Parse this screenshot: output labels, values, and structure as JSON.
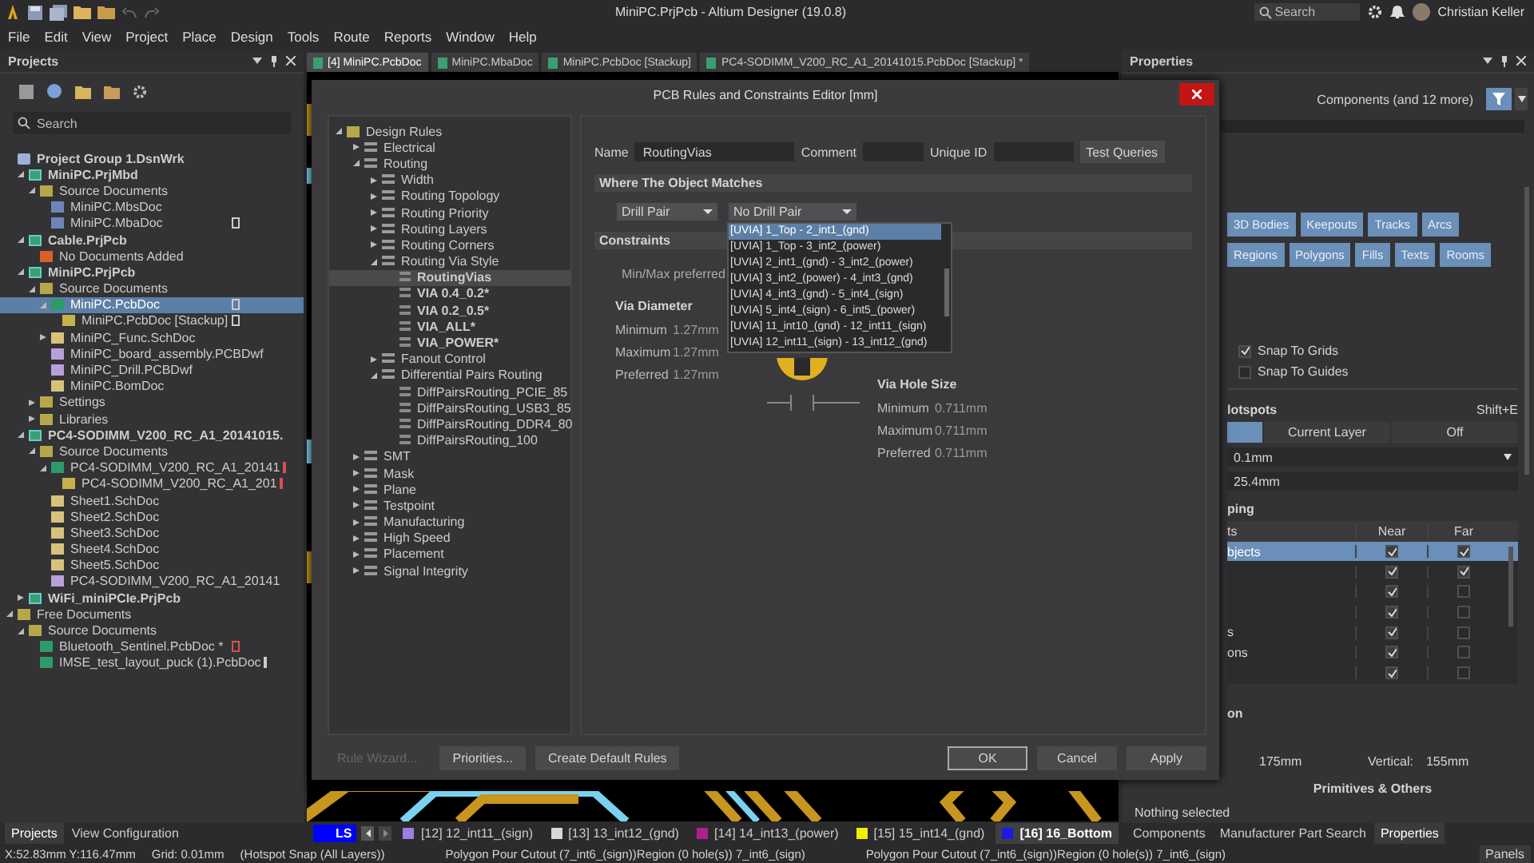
{
  "titlebar": {
    "title": "MiniPC.PrjPcb - Altium Designer (19.0.8)",
    "search": {
      "placeholder": "Search"
    },
    "user": "Christian Keller"
  },
  "menu": [
    "File",
    "Edit",
    "View",
    "Project",
    "Place",
    "Design",
    "Tools",
    "Route",
    "Reports",
    "Window",
    "Help"
  ],
  "projects_panel": {
    "title": "Projects",
    "search": {
      "placeholder": "Search"
    },
    "tree": [
      {
        "label": "Project Group 1.DsnWrk",
        "kind": "workspace",
        "selected": false,
        "children": [
          {
            "label": "MiniPC.PrjMbd",
            "kind": "project",
            "selected": false,
            "expanded": true,
            "children": [
              {
                "label": "Source Documents",
                "kind": "folder",
                "selected": false,
                "expanded": true,
                "children": [
                  {
                    "label": "MiniPC.MbsDoc",
                    "kind": "doc",
                    "selected": false
                  },
                  {
                    "label": "MiniPC.MbaDoc",
                    "kind": "doc",
                    "selected": false,
                    "modified": false
                  }
                ]
              }
            ]
          },
          {
            "label": "Cable.PrjPcb",
            "kind": "project",
            "selected": false,
            "expanded": true,
            "children": [
              {
                "label": "No Documents Added",
                "kind": "empty",
                "selected": false
              }
            ]
          },
          {
            "label": "MiniPC.PrjPcb",
            "kind": "project",
            "selected": false,
            "expanded": true,
            "children": [
              {
                "label": "Source Documents",
                "kind": "folder",
                "selected": false,
                "expanded": true,
                "children": [
                  {
                    "label": "MiniPC.PcbDoc",
                    "kind": "pcb",
                    "selected": true,
                    "expanded": true,
                    "modified": false,
                    "children": [
                      {
                        "label": "MiniPC.PcbDoc [Stackup]",
                        "kind": "stackup",
                        "selected": false,
                        "modified": false
                      }
                    ]
                  },
                  {
                    "label": "MiniPC_Func.SchDoc",
                    "kind": "sch",
                    "selected": false,
                    "expanded": false
                  },
                  {
                    "label": "MiniPC_board_assembly.PCBDwf",
                    "kind": "dwf",
                    "selected": false
                  },
                  {
                    "label": "MiniPC_Drill.PCBDwf",
                    "kind": "dwf",
                    "selected": false
                  },
                  {
                    "label": "MiniPC.BomDoc",
                    "kind": "sch",
                    "selected": false
                  }
                ]
              },
              {
                "label": "Settings",
                "kind": "folder",
                "selected": false,
                "expanded": false
              },
              {
                "label": "Libraries",
                "kind": "folder",
                "selected": false,
                "expanded": false
              }
            ]
          },
          {
            "label": "PC4-SODIMM_V200_RC_A1_20141015.",
            "kind": "project",
            "selected": false,
            "expanded": true,
            "children": [
              {
                "label": "Source Documents",
                "kind": "folder",
                "selected": false,
                "expanded": true,
                "children": [
                  {
                    "label": "PC4-SODIMM_V200_RC_A1_20141",
                    "kind": "pcb",
                    "selected": false,
                    "expanded": true,
                    "modified": true,
                    "children": [
                      {
                        "label": "PC4-SODIMM_V200_RC_A1_201",
                        "kind": "stackup",
                        "selected": false,
                        "modified": true
                      }
                    ]
                  },
                  {
                    "label": "Sheet1.SchDoc",
                    "kind": "sch",
                    "selected": false
                  },
                  {
                    "label": "Sheet2.SchDoc",
                    "kind": "sch",
                    "selected": false
                  },
                  {
                    "label": "Sheet3.SchDoc",
                    "kind": "sch",
                    "selected": false
                  },
                  {
                    "label": "Sheet4.SchDoc",
                    "kind": "sch",
                    "selected": false
                  },
                  {
                    "label": "Sheet5.SchDoc",
                    "kind": "sch",
                    "selected": false
                  },
                  {
                    "label": "PC4-SODIMM_V200_RC_A1_20141",
                    "kind": "dwf",
                    "selected": false
                  }
                ]
              }
            ]
          },
          {
            "label": "WiFi_miniPCIe.PrjPcb",
            "kind": "project",
            "selected": false,
            "expanded": false
          }
        ]
      },
      {
        "label": "Free Documents",
        "kind": "folder",
        "selected": false,
        "expanded": true,
        "children": [
          {
            "label": "Source Documents",
            "kind": "folder",
            "selected": false,
            "expanded": true,
            "children": [
              {
                "label": "Bluetooth_Sentinel.PcbDoc *",
                "kind": "pcb",
                "selected": false,
                "modified": true
              },
              {
                "label": "IMSE_test_layout_puck (1).PcbDoc",
                "kind": "pcb",
                "selected": false,
                "modified": false
              }
            ]
          }
        ]
      }
    ],
    "tabs": [
      {
        "label": "Projects",
        "selected": true
      },
      {
        "label": "View Configuration",
        "selected": false
      }
    ]
  },
  "document_tabs": [
    {
      "label": "[4] MiniPC.PcbDoc",
      "selected": true
    },
    {
      "label": "MiniPC.MbaDoc",
      "selected": false
    },
    {
      "label": "MiniPC.PcbDoc [Stackup]",
      "selected": false
    },
    {
      "label": "PC4-SODIMM_V200_RC_A1_20141015.PcbDoc [Stackup] *",
      "selected": false
    }
  ],
  "dialog": {
    "title": "PCB Rules and Constraints Editor [mm]",
    "rule_tree": [
      {
        "label": "Design Rules",
        "kind": "root",
        "selected": false,
        "expanded": true,
        "children": [
          {
            "label": "Electrical",
            "kind": "category",
            "selected": false,
            "expanded": false
          },
          {
            "label": "Routing",
            "kind": "category",
            "selected": false,
            "expanded": true,
            "children": [
              {
                "label": "Width",
                "kind": "category",
                "selected": false,
                "expanded": false
              },
              {
                "label": "Routing Topology",
                "kind": "category",
                "selected": false,
                "expanded": false
              },
              {
                "label": "Routing Priority",
                "kind": "category",
                "selected": false,
                "expanded": false
              },
              {
                "label": "Routing Layers",
                "kind": "category",
                "selected": false,
                "expanded": false
              },
              {
                "label": "Routing Corners",
                "kind": "category",
                "selected": false,
                "expanded": false
              },
              {
                "label": "Routing Via Style",
                "kind": "category",
                "selected": false,
                "expanded": true,
                "children": [
                  {
                    "label": "RoutingVias",
                    "kind": "rule",
                    "selected": true,
                    "bold": true
                  },
                  {
                    "label": "VIA 0.4_0.2*",
                    "kind": "rule",
                    "selected": false,
                    "bold": true
                  },
                  {
                    "label": "VIA 0.2_0.5*",
                    "kind": "rule",
                    "selected": false,
                    "bold": true
                  },
                  {
                    "label": "VIA_ALL*",
                    "kind": "rule",
                    "selected": false,
                    "bold": true
                  },
                  {
                    "label": "VIA_POWER*",
                    "kind": "rule",
                    "selected": false,
                    "bold": true
                  }
                ]
              },
              {
                "label": "Fanout Control",
                "kind": "category",
                "selected": false,
                "expanded": false
              },
              {
                "label": "Differential Pairs Routing",
                "kind": "category",
                "selected": false,
                "expanded": true,
                "children": [
                  {
                    "label": "DiffPairsRouting_PCIE_85",
                    "kind": "rule",
                    "selected": false,
                    "bold": false
                  },
                  {
                    "label": "DiffPairsRouting_USB3_85",
                    "kind": "rule",
                    "selected": false,
                    "bold": false
                  },
                  {
                    "label": "DiffPairsRouting_DDR4_80",
                    "kind": "rule",
                    "selected": false,
                    "bold": false
                  },
                  {
                    "label": "DiffPairsRouting_100",
                    "kind": "rule",
                    "selected": false,
                    "bold": false
                  }
                ]
              }
            ]
          },
          {
            "label": "SMT",
            "kind": "category",
            "selected": false,
            "expanded": false
          },
          {
            "label": "Mask",
            "kind": "category",
            "selected": false,
            "expanded": false
          },
          {
            "label": "Plane",
            "kind": "category",
            "selected": false,
            "expanded": false
          },
          {
            "label": "Testpoint",
            "kind": "category",
            "selected": false,
            "expanded": false
          },
          {
            "label": "Manufacturing",
            "kind": "category",
            "selected": false,
            "expanded": false
          },
          {
            "label": "High Speed",
            "kind": "category",
            "selected": false,
            "expanded": false
          },
          {
            "label": "Placement",
            "kind": "category",
            "selected": false,
            "expanded": false
          },
          {
            "label": "Signal Integrity",
            "kind": "category",
            "selected": false,
            "expanded": false
          }
        ]
      }
    ],
    "name_label": "Name",
    "name": "RoutingVias",
    "comment_label": "Comment",
    "unique_id_label": "Unique ID",
    "test_queries": "Test Queries",
    "where_header": "Where The Object Matches",
    "match_type": "Drill Pair",
    "match_value": "No Drill Pair",
    "dropdown_options": [
      {
        "label": "[UVIA] 1_Top - 2_int1_(gnd)",
        "selected": true
      },
      {
        "label": "[UVIA] 1_Top - 3_int2_(power)",
        "selected": false
      },
      {
        "label": "[UVIA] 2_int1_(gnd) - 3_int2_(power)",
        "selected": false
      },
      {
        "label": "[UVIA] 3_int2_(power) - 4_int3_(gnd)",
        "selected": false
      },
      {
        "label": "[UVIA] 4_int3_(gnd) - 5_int4_(sign)",
        "selected": false
      },
      {
        "label": "[UVIA] 5_int4_(sign) - 6_int5_(power)",
        "selected": false
      },
      {
        "label": "[UVIA] 11_int10_(gnd) - 12_int11_(sign)",
        "selected": false
      },
      {
        "label": "[UVIA] 12_int11_(sign) - 13_int12_(gnd)",
        "selected": false
      }
    ],
    "constraints_header": "Constraints",
    "minmax_label": "Min/Max preferred",
    "via_diameter": {
      "title": "Via Diameter",
      "rows": [
        {
          "label": "Minimum",
          "value": "1.27mm"
        },
        {
          "label": "Maximum",
          "value": "1.27mm"
        },
        {
          "label": "Preferred",
          "value": "1.27mm"
        }
      ]
    },
    "via_hole": {
      "title": "Via Hole Size",
      "rows": [
        {
          "label": "Minimum",
          "value": "0.711mm"
        },
        {
          "label": "Maximum",
          "value": "0.711mm"
        },
        {
          "label": "Preferred",
          "value": "0.711mm"
        }
      ]
    },
    "buttons_left": [
      {
        "label": "Rule Wizard...",
        "disabled": true
      },
      {
        "label": "Priorities...",
        "disabled": false
      },
      {
        "label": "Create Default Rules",
        "disabled": false
      }
    ],
    "buttons_right": [
      {
        "label": "OK",
        "default": true
      },
      {
        "label": "Cancel",
        "default": false
      },
      {
        "label": "Apply",
        "default": false
      }
    ]
  },
  "layer_bar": {
    "current_layer": {
      "label": "LS",
      "color": "#0000ff"
    },
    "layers": [
      {
        "label": "[12] 12_int11_(sign)",
        "color": "#9c7fe0",
        "selected": false
      },
      {
        "label": "[13] 13_int12_(gnd)",
        "color": "#d8d8d8",
        "selected": false
      },
      {
        "label": "[14] 14_int13_(power)",
        "color": "#b0208c",
        "selected": false
      },
      {
        "label": "[15] 15_int14_(gnd)",
        "color": "#f0f000",
        "selected": false
      },
      {
        "label": "[16] 16_Bottom",
        "color": "#1a1ae6",
        "selected": true
      }
    ]
  },
  "properties": {
    "title": "Properties",
    "filter": "Components (and 12 more)",
    "object_buttons": [
      [
        "3D Bodies",
        "Keepouts",
        "Tracks",
        "Arcs"
      ],
      [
        "Regions",
        "Polygons",
        "Fills",
        "Texts",
        "Rooms"
      ]
    ],
    "snap_options": [
      {
        "label": "Snap To Grids",
        "checked": true
      },
      {
        "label": "Snap To Guides",
        "checked": false
      }
    ],
    "hotspots_header": "lotspots",
    "hotspots_shortcut": "Shift+E",
    "hotspot_modes": [
      {
        "selected": true
      },
      {
        "label": "Current Layer",
        "selected": false
      },
      {
        "label": "Off",
        "selected": false
      }
    ],
    "snap_distance": "0.1mm",
    "axis_distance": "25.4mm",
    "snapping_header": "ping",
    "table": {
      "columns": [
        "ts",
        "Near",
        "Far"
      ],
      "rows": [
        {
          "label": "bjects",
          "selected": true,
          "near": true,
          "far": true
        },
        {
          "selected": false,
          "near": true,
          "far": true
        },
        {
          "selected": false,
          "near": true,
          "far": false
        },
        {
          "selected": false,
          "near": true,
          "far": false
        },
        {
          "label": "s",
          "selected": false,
          "near": true,
          "far": false
        },
        {
          "label": "ons",
          "selected": false,
          "near": true,
          "far": false
        },
        {
          "selected": false,
          "near": true,
          "far": false
        }
      ]
    },
    "section_header": "on",
    "width_value": "175mm",
    "vertical_label": "Vertical:",
    "vertical_value": "155mm",
    "primitives_header": "Primitives & Others",
    "selection_status": "Nothing selected",
    "tabs": [
      {
        "label": "Components",
        "selected": false
      },
      {
        "label": "Manufacturer Part Search",
        "selected": false
      },
      {
        "label": "Properties",
        "selected": true
      }
    ]
  },
  "status_bar": {
    "coords": "X:52.83mm Y:116.47mm",
    "grid": "Grid: 0.01mm",
    "snap": "(Hotspot Snap (All Layers))",
    "messages": [
      "Polygon Pour Cutout (7_int6_(sign))Region (0 hole(s)) 7_int6_(sign)",
      "Polygon Pour Cutout (7_int6_(sign))Region (0 hole(s)) 7_int6_(sign)"
    ],
    "panels": "Panels"
  }
}
